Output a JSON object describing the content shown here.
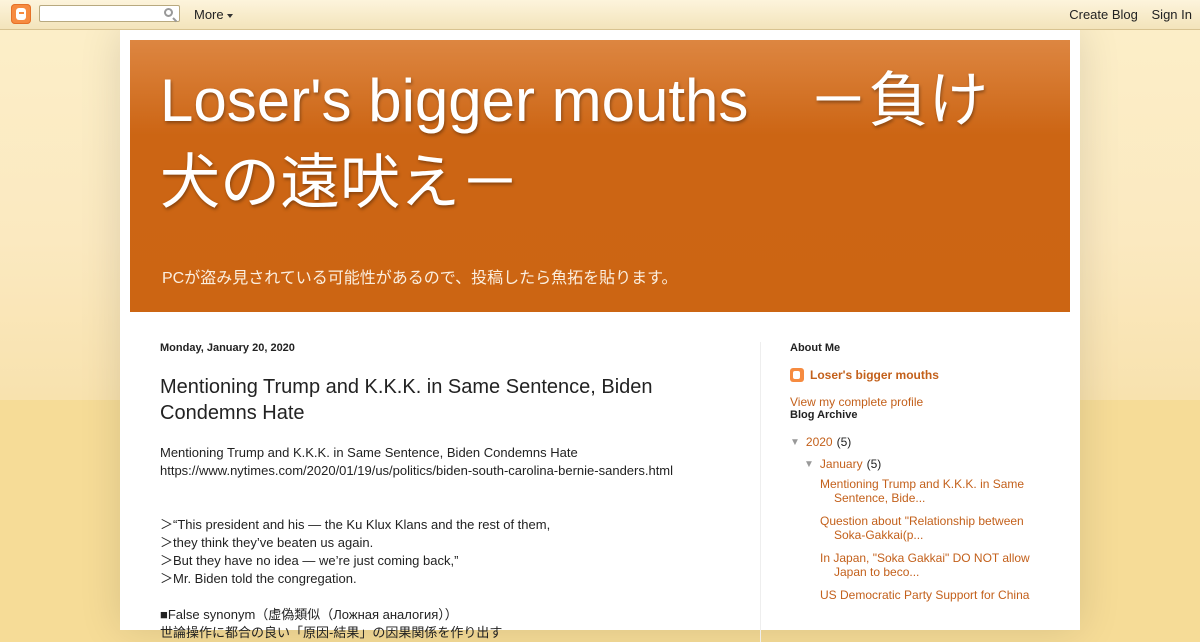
{
  "navbar": {
    "more_label": "More",
    "create_blog": "Create Blog",
    "sign_in": "Sign In",
    "logo_icon": "blogger-icon",
    "search_icon": "search-icon"
  },
  "header": {
    "title_line1": "Loser's bigger mouths　－負け",
    "title_line2": "犬の遠吠え－",
    "description": "PCが盗み見されている可能性があるので、投稿したら魚拓を貼ります。"
  },
  "post": {
    "date": "Monday, January 20, 2020",
    "title": "Mentioning Trump and K.K.K. in Same Sentence, Biden Condemns Hate",
    "body": [
      "Mentioning Trump and K.K.K. in Same Sentence, Biden Condemns Hate",
      "https://www.nytimes.com/2020/01/19/us/politics/biden-south-carolina-bernie-sanders.html",
      "",
      "",
      "＞“This president and his — the Ku Klux Klans and the rest of them,",
      "＞they think they’ve beaten us again.",
      "＞But they have no idea — we’re just coming back,”",
      "＞Mr. Biden told the congregation.",
      "",
      "■False synonym（虚偽類似（Ложная аналогия））",
      "世論操作に都合の良い「原因-結果」の因果関係を作り出す"
    ]
  },
  "sidebar": {
    "about_heading": "About Me",
    "profile_name": "Loser's bigger mouths",
    "view_profile": "View my complete profile",
    "archive_heading": "Blog Archive",
    "year": "2020",
    "year_count": "(5)",
    "month": "January",
    "month_count": "(5)",
    "posts": [
      {
        "l1": "Mentioning Trump and K.K.K. in Same",
        "l2": "Sentence, Bide..."
      },
      {
        "l1": "Question about \"Relationship between",
        "l2": "Soka-Gakkai(p..."
      },
      {
        "l1": "In Japan, \"Soka Gakkai\" DO NOT allow",
        "l2": "Japan to beco..."
      },
      {
        "l1": "US Democratic Party Support for China",
        "l2": ""
      }
    ]
  }
}
